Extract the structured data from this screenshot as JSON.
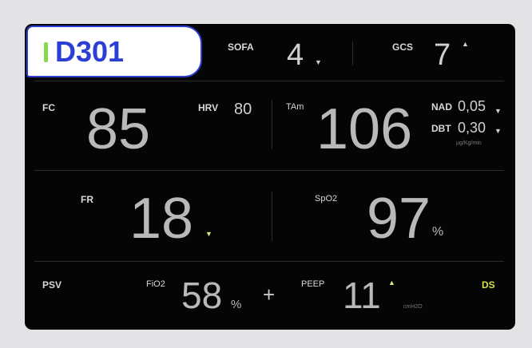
{
  "bed": {
    "id": "D301"
  },
  "scores": {
    "sofa": {
      "label": "SOFA",
      "value": "4",
      "trend": "▼"
    },
    "gcs": {
      "label": "GCS",
      "value": "7",
      "trend": "▲"
    }
  },
  "vitals": {
    "fc": {
      "label": "FC",
      "value": "85"
    },
    "hrv": {
      "label": "HRV",
      "value": "80"
    },
    "tam": {
      "label": "TAm",
      "value": "106"
    },
    "nad": {
      "label": "NAD",
      "value": "0,05",
      "trend": "▼"
    },
    "dbt": {
      "label": "DBT",
      "value": "0,30",
      "trend": "▼"
    },
    "drug_unit": "µg/Kg/min",
    "fr": {
      "label": "FR",
      "value": "18",
      "trend": "▼"
    },
    "spo2": {
      "label": "SpO2",
      "value": "97",
      "unit": "%"
    }
  },
  "ventilation": {
    "mode": "PSV",
    "fio2": {
      "label": "FiO2",
      "value": "58",
      "unit": "%"
    },
    "plus": "+",
    "peep": {
      "label": "PEEP",
      "value": "11",
      "unit": "cmH2O",
      "trend": "▲"
    },
    "ds": "DS"
  },
  "colors": {
    "accent": "#2b3fd6",
    "bed_indicator": "#86d94b",
    "trend_yellow": "#e2e67a",
    "ds_label": "#d6e04a",
    "background": "#050505"
  }
}
